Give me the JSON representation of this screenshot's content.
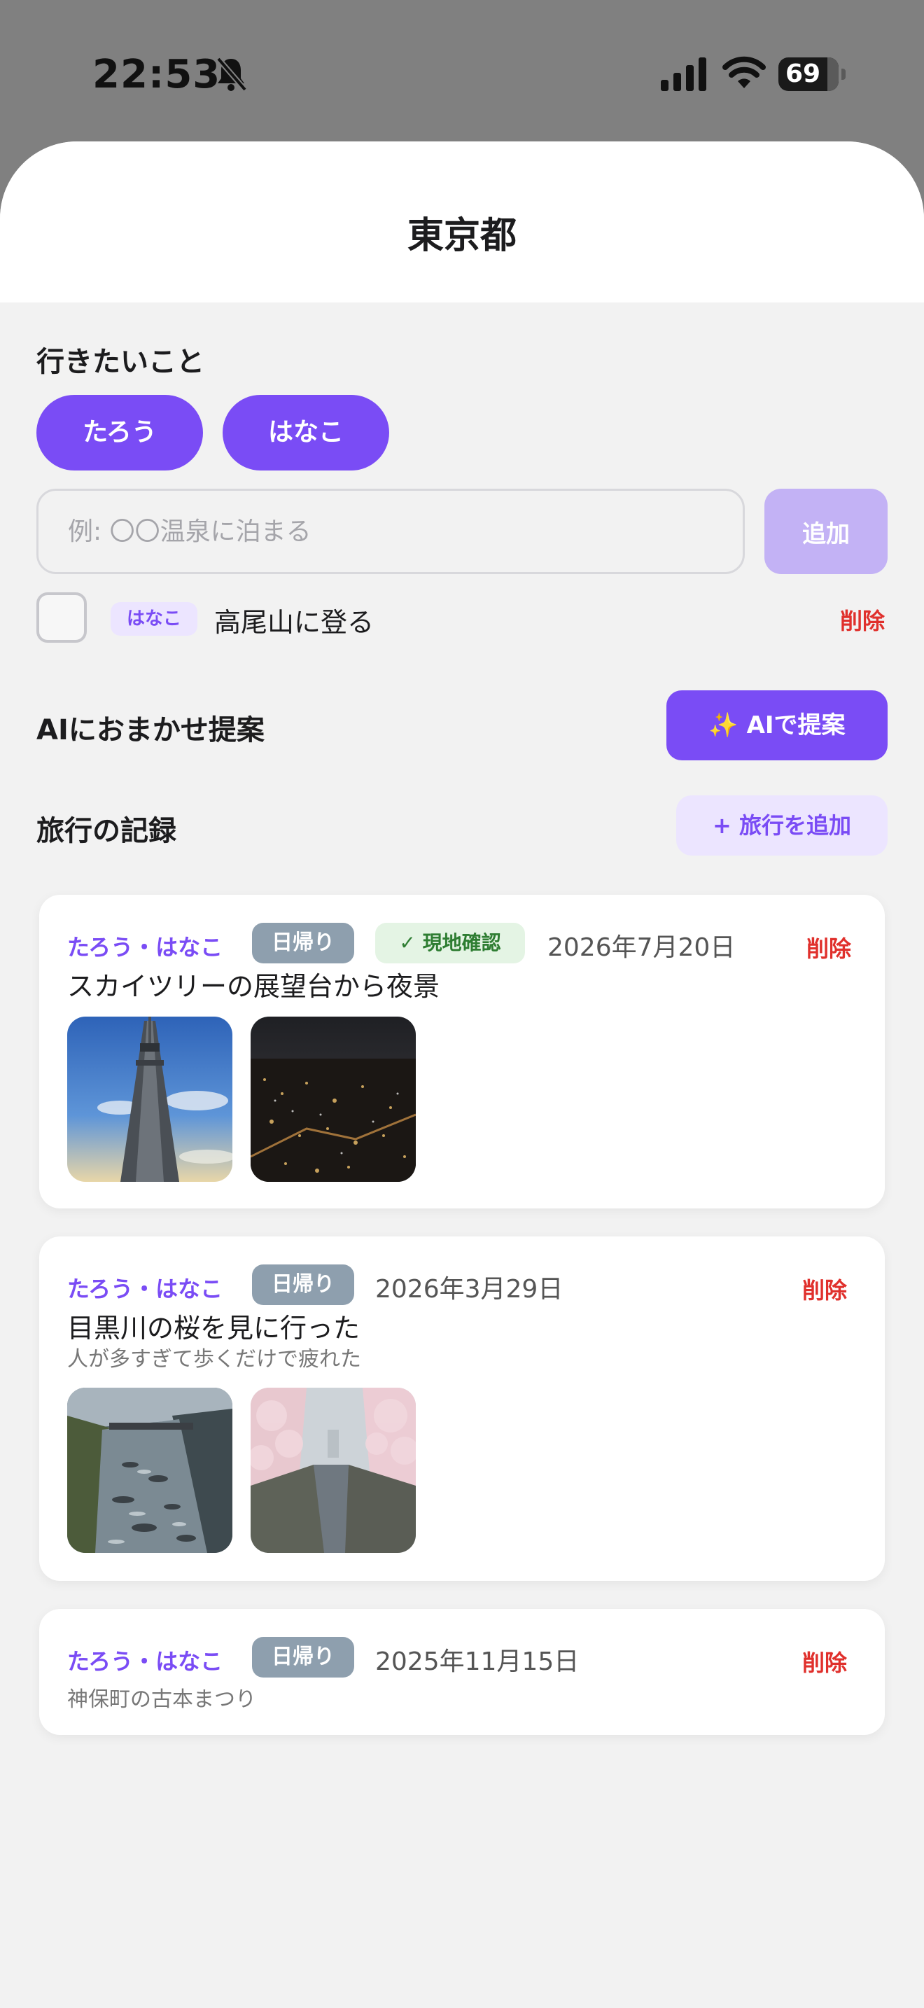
{
  "status": {
    "time": "22:53",
    "battery": "69",
    "battery_level": 0.69
  },
  "sheet": {
    "title": "東京都"
  },
  "wishlist": {
    "heading": "行きたいこと",
    "members": [
      "たろう",
      "はなこ"
    ],
    "input_placeholder": "例: 〇〇温泉に泊まる",
    "add_label": "追加",
    "items": [
      {
        "assignee": "はなこ",
        "text": "高尾山に登る",
        "delete_label": "削除"
      }
    ]
  },
  "ai": {
    "heading": "AIにおまかせ提案",
    "button_label": "✨ AIで提案"
  },
  "trips": {
    "heading": "旅行の記録",
    "add_label": "+ 旅行を追加",
    "cards": [
      {
        "participants": "たろう・はなこ",
        "type_tag": "日帰り",
        "verified_tag": "✓ 現地確認",
        "date": "2026年7月20日",
        "title": "スカイツリーの展望台から夜景",
        "delete_label": "削除",
        "photos": [
          "skytree-photo",
          "night-view-photo"
        ]
      },
      {
        "participants": "たろう・はなこ",
        "type_tag": "日帰り",
        "date": "2026年3月29日",
        "title": "目黒川の桜を見に行った",
        "note": "人が多すぎて歩くだけで疲れた",
        "delete_label": "削除",
        "photos": [
          "river-photo",
          "cherry-blossom-photo"
        ]
      },
      {
        "participants": "たろう・はなこ",
        "type_tag": "日帰り",
        "date": "2025年11月15日",
        "note": "神保町の古本まつり",
        "delete_label": "削除"
      }
    ]
  },
  "colors": {
    "accent": "#7a4cf5",
    "accent_light": "#ece5ff",
    "danger": "#e0302c",
    "tag_gray": "#8e9fae",
    "verified_bg": "#e4f4e4",
    "verified_text": "#2e7d32"
  }
}
